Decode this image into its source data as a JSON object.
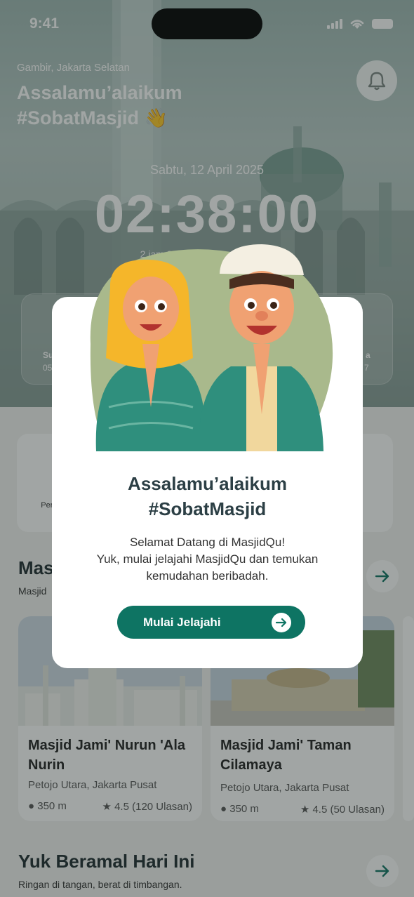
{
  "status_bar": {
    "time": "9:41"
  },
  "header": {
    "location": "Gambir, Jakarta Selatan",
    "greeting_line1": "Assalamu’alaikum",
    "greeting_line2": "#SobatMasjid 👋"
  },
  "prayer_time": {
    "date": "Sabtu, 12 April 2025",
    "countdown": "02:38:00",
    "subtitle": "2 jam 38 menit menuju Dzuhur",
    "items": [
      {
        "label": "Su",
        "time": "05"
      },
      {
        "label": "a",
        "time": "7"
      }
    ]
  },
  "menu": {
    "items": [
      {
        "label": "Per S"
      },
      {
        "label": "n"
      }
    ]
  },
  "nearby": {
    "title": "Mas",
    "subtitle": "Masjid",
    "cards": [
      {
        "name": "Masjid Jami' Nurun 'Ala Nurin",
        "address": "Petojo Utara, Jakarta Pusat",
        "distance": "350 m",
        "rating": "4.5 (120 Ulasan)"
      },
      {
        "name": "Masjid Jami' Taman Cilamaya",
        "address": "Petojo Utara, Jakarta Pusat",
        "distance": "350 m",
        "rating": "4.5 (50 Ulasan)"
      }
    ]
  },
  "amal": {
    "title": "Yuk Beramal Hari Ini",
    "subtitle": "Ringan di tangan, berat di timbangan."
  },
  "modal": {
    "title_line1": "Assalamu’alaikum",
    "title_line2": "#SobatMasjid",
    "text_line1": "Selamat Datang di MasjidQu!",
    "text_line2": "Yuk, mulai jelajahi MasjidQu dan temukan",
    "text_line3": "kemudahan beribadah.",
    "cta_label": "Mulai Jelajahi"
  },
  "colors": {
    "primary": "#0e7463",
    "title_dark": "#2c3f45",
    "illustration_blob": "#a9b98c"
  }
}
